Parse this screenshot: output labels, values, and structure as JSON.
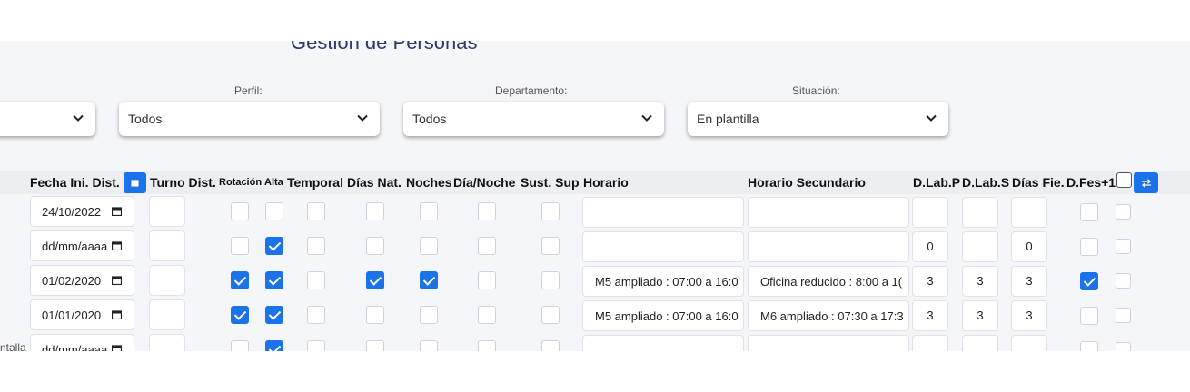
{
  "page": {
    "title": "Gestión de Personas"
  },
  "filters": {
    "perfil": {
      "label": "Perfil:",
      "value": "Todos"
    },
    "departamento": {
      "label": "Departamento:",
      "value": "Todos"
    },
    "situacion": {
      "label": "Situación:",
      "value": "En plantilla"
    }
  },
  "columns": {
    "fecha": "Fecha Ini. Dist.",
    "turno": "Turno Dist.",
    "rotacion": "Rotación",
    "alta": "Alta",
    "temporal": "Temporal",
    "dias_nat": "Días Nat.",
    "noches": "Noches",
    "dia_noche": "Día/Noche",
    "sust_sup": "Sust. Sup",
    "horario": "Horario",
    "horario_sec": "Horario Secundario",
    "dlabp": "D.Lab.P",
    "dlabs": "D.Lab.S",
    "dias_fie": "Días Fie.",
    "dfes": "D.Fes+1"
  },
  "rows": [
    {
      "fecha": "24/10/2022",
      "turno": "",
      "rotacion": false,
      "alta": false,
      "temporal": false,
      "dias_nat": false,
      "noches": false,
      "dia_noche": false,
      "sust_sup": false,
      "horario": "",
      "horario_sec": "",
      "dlabp": "",
      "dlabs": "",
      "dias_fie": "",
      "dfes": false,
      "sel": false
    },
    {
      "fecha": "dd/mm/aaaa",
      "turno": "",
      "rotacion": false,
      "alta": true,
      "temporal": false,
      "dias_nat": false,
      "noches": false,
      "dia_noche": false,
      "sust_sup": false,
      "horario": "",
      "horario_sec": "",
      "dlabp": "0",
      "dlabs": "",
      "dias_fie": "0",
      "dfes": false,
      "sel": false
    },
    {
      "fecha": "01/02/2020",
      "turno": "",
      "rotacion": true,
      "alta": true,
      "temporal": false,
      "dias_nat": true,
      "noches": true,
      "dia_noche": false,
      "sust_sup": false,
      "horario": "M5 ampliado : 07:00 a 16:0",
      "horario_sec": "Oficina reducido : 8:00 a 1(",
      "dlabp": "3",
      "dlabs": "3",
      "dias_fie": "3",
      "dfes": true,
      "sel": false
    },
    {
      "fecha": "01/01/2020",
      "turno": "",
      "rotacion": true,
      "alta": true,
      "temporal": false,
      "dias_nat": false,
      "noches": false,
      "dia_noche": false,
      "sust_sup": false,
      "horario": "M5 ampliado : 07:00 a 16:0",
      "horario_sec": "M6 ampliado : 07:30 a 17:3",
      "dlabp": "3",
      "dlabs": "3",
      "dias_fie": "3",
      "dfes": false,
      "sel": false
    },
    {
      "fecha": "dd/mm/aaaa",
      "turno": "",
      "rotacion": false,
      "alta": true,
      "temporal": false,
      "dias_nat": false,
      "noches": false,
      "dia_noche": false,
      "sust_sup": false,
      "horario": "",
      "horario_sec": "",
      "dlabp": "",
      "dlabs": "",
      "dias_fie": "",
      "dfes": false,
      "sel": false
    }
  ],
  "left_cut_label": "ntalla",
  "colors": {
    "accent": "#1a73e8",
    "title": "#2b3a67"
  }
}
